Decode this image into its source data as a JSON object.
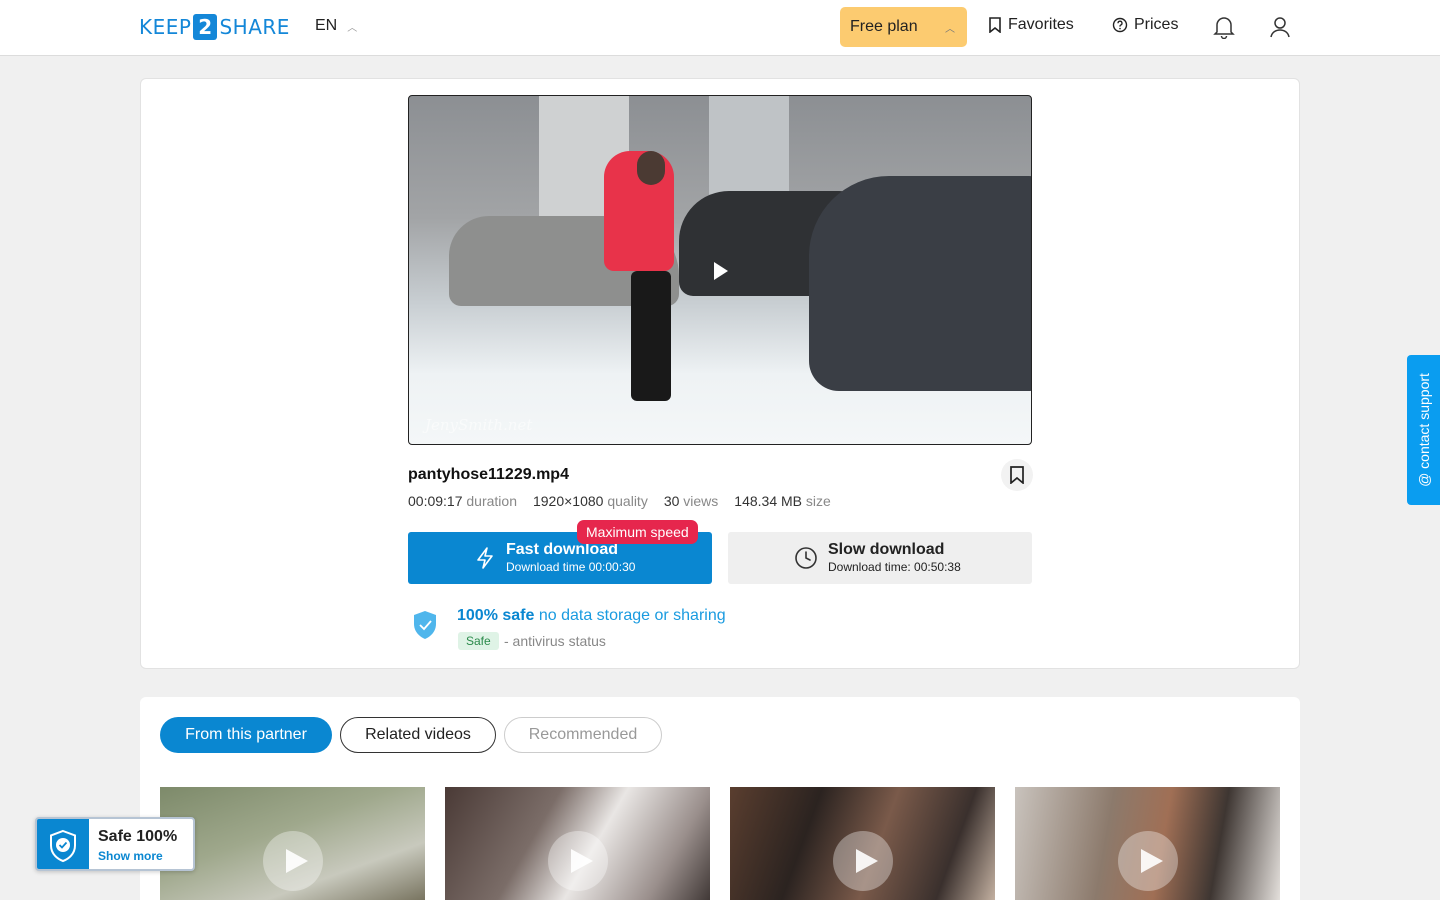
{
  "header": {
    "logo_left": "KEEP",
    "logo_num": "2",
    "logo_right": "SHARE",
    "language": "EN",
    "plan_label": "Free plan",
    "favorites_label": "Favorites",
    "prices_label": "Prices",
    "icons": [
      "bell-icon",
      "user-icon",
      "bookmark-icon",
      "help-circle-icon"
    ]
  },
  "file": {
    "name": "pantyhose11229.mp4",
    "watermark": "JenySmith.net",
    "duration_value": "00:09:17",
    "duration_label": "duration",
    "quality_value": "1920×1080",
    "quality_label": "quality",
    "views_value": "30",
    "views_label": "views",
    "size_value": "148.34 MB",
    "size_label": "size"
  },
  "downloads": {
    "fast_title": "Fast download",
    "fast_time": "Download time 00:00:30",
    "max_speed_badge": "Maximum speed",
    "slow_title": "Slow download",
    "slow_time": "Download time: 00:50:38"
  },
  "safety": {
    "strong": "100% safe",
    "link": "no data storage or sharing",
    "badge": "Safe",
    "status": "- antivirus status"
  },
  "support_tab": "@ contact support",
  "tabs": [
    "From this partner",
    "Related videos",
    "Recommended"
  ],
  "safe_widget": {
    "title": "Safe 100%",
    "link": "Show more"
  },
  "colors": {
    "accent": "#0a87d1",
    "plan": "#fccb70",
    "badge_red": "#e6264d"
  }
}
